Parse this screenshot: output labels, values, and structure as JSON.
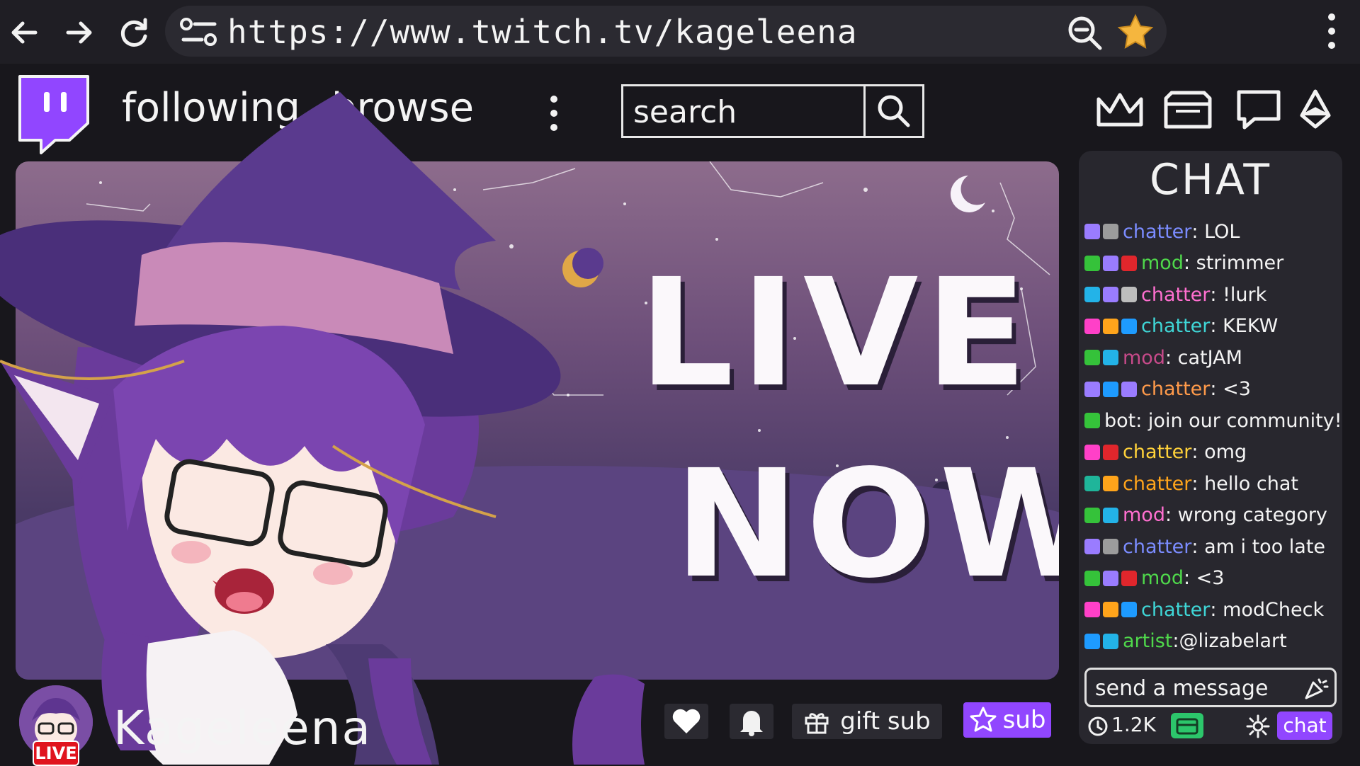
{
  "browser": {
    "url": "https://www.twitch.tv/kageleena",
    "back_icon": "arrow-left-icon",
    "forward_icon": "arrow-right-icon",
    "reload_icon": "reload-icon"
  },
  "header": {
    "nav": [
      "following",
      "browse"
    ],
    "search_placeholder": "search"
  },
  "player": {
    "line1": "LIVE",
    "line2": "NOW"
  },
  "chat": {
    "title": "CHAT",
    "messages": [
      {
        "user": "chatter",
        "text": ": LOL",
        "color": "#7b8cff",
        "badges": [
          "#9a7cff",
          "#9c9c9c"
        ]
      },
      {
        "user": "mod",
        "text": ": strimmer",
        "color": "#4fd84b",
        "badges": [
          "#35c23a",
          "#9a7cff",
          "#e0262c"
        ]
      },
      {
        "user": "chatter",
        "text": ": !lurk",
        "color": "#ff6fd0",
        "badges": [
          "#23b3e8",
          "#9a7cff",
          "#bdbdbd"
        ]
      },
      {
        "user": "chatter",
        "text": ": KEKW",
        "color": "#3fd6d6",
        "badges": [
          "#ff40c8",
          "#ffa41b",
          "#1e9bff"
        ]
      },
      {
        "user": "mod",
        "text": ": catJAM",
        "color": "#c74a8a",
        "badges": [
          "#35c23a",
          "#23b3e8"
        ]
      },
      {
        "user": "chatter",
        "text": ": <3",
        "color": "#ff9a4a",
        "badges": [
          "#9a7cff",
          "#1e9bff",
          "#9a7cff"
        ]
      },
      {
        "user": "bot",
        "text": ": join our community!",
        "color": "#f4f4f4",
        "badges": [
          "#35c23a"
        ]
      },
      {
        "user": "chatter",
        "text": ": omg",
        "color": "#ffd23a",
        "badges": [
          "#ff40c8",
          "#e0262c"
        ]
      },
      {
        "user": "chatter",
        "text": ": hello chat",
        "color": "#ffa41b",
        "badges": [
          "#1fb59a",
          "#ffa41b"
        ]
      },
      {
        "user": "mod",
        "text": ": wrong category",
        "color": "#ff6fd0",
        "badges": [
          "#35c23a",
          "#23b3e8"
        ]
      },
      {
        "user": "chatter",
        "text": ": am i too late",
        "color": "#7b8cff",
        "badges": [
          "#9a7cff",
          "#9c9c9c"
        ]
      },
      {
        "user": "mod",
        "text": ": <3",
        "color": "#4fd84b",
        "badges": [
          "#35c23a",
          "#9a7cff",
          "#e0262c"
        ]
      },
      {
        "user": "chatter",
        "text": ": modCheck",
        "color": "#3fd6d6",
        "badges": [
          "#ff40c8",
          "#ffa41b",
          "#1e9bff"
        ]
      },
      {
        "user": "artist",
        "text": ":@lizabelart",
        "color": "#4fd84b",
        "badges": [
          "#1e9bff",
          "#23b3e8"
        ]
      }
    ],
    "send_placeholder": "send a message",
    "viewers": "1.2K",
    "chat_button": "chat"
  },
  "streamer": {
    "name": "Kageleena",
    "live_badge": "LIVE"
  },
  "actions": {
    "gift_sub": "gift sub",
    "sub": "sub"
  },
  "colors": {
    "twitch_purple": "#9146ff",
    "background": "#18171c",
    "live_red": "#e0141e"
  }
}
